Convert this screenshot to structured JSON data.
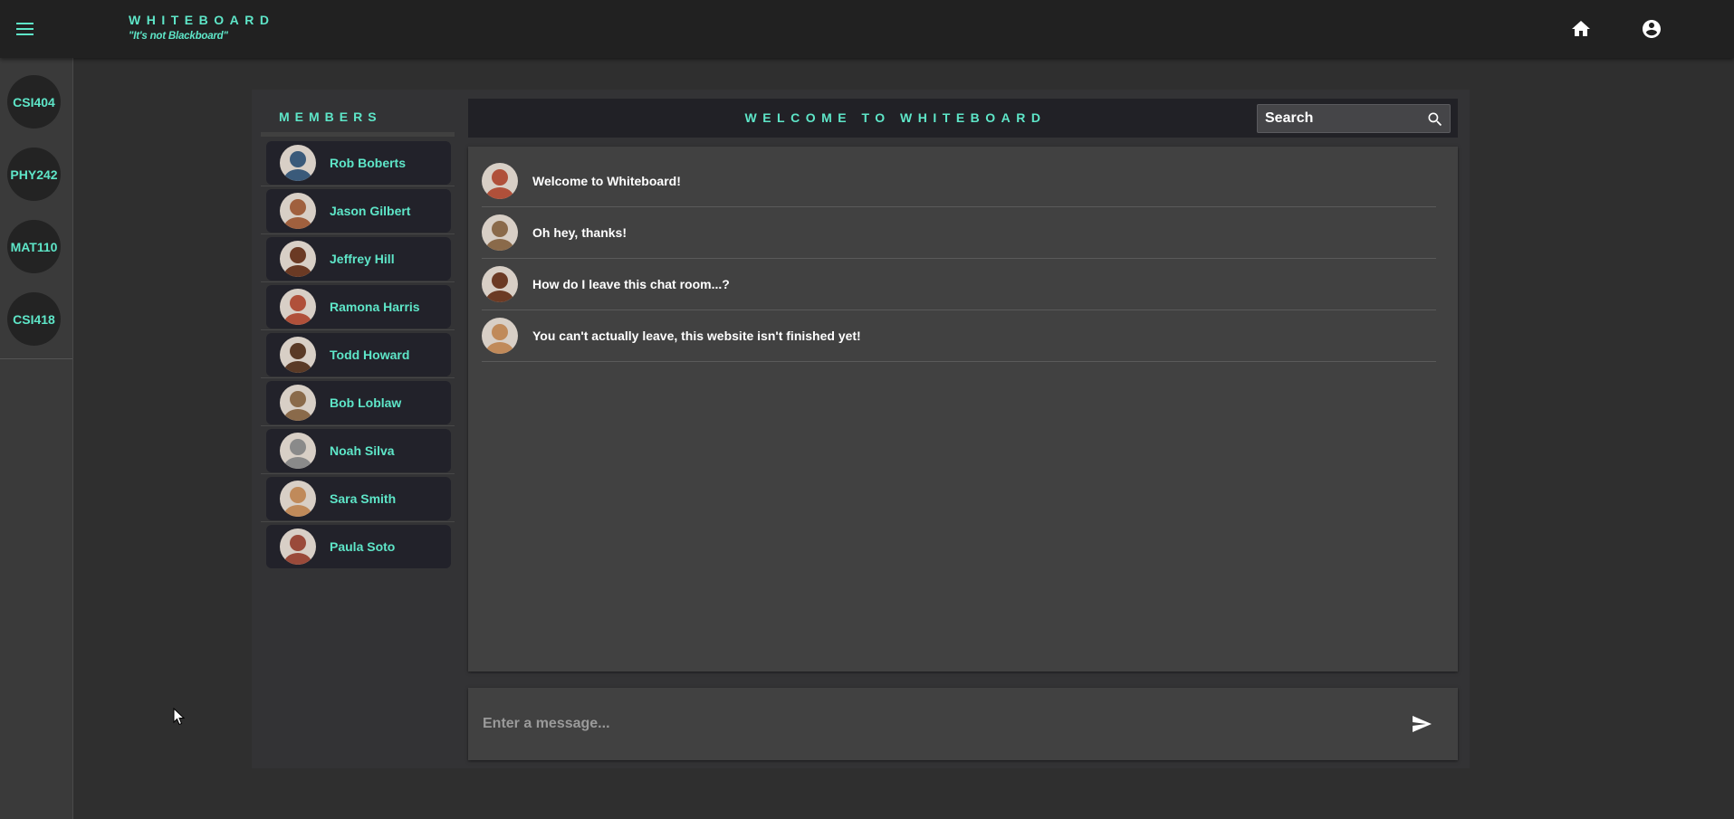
{
  "app": {
    "brand_title": "WHITEBOARD",
    "brand_subtitle": "\"It's not Blackboard\"",
    "accent_color": "#5ee6c8"
  },
  "topbar": {
    "menu_icon": "hamburger-menu-icon",
    "home_icon": "home-icon",
    "account_icon": "account-circle-icon"
  },
  "courses": [
    "CSI404",
    "PHY242",
    "MAT110",
    "CSI418"
  ],
  "members": {
    "title": "MEMBERS",
    "items": [
      {
        "name": "Rob Boberts",
        "avatar_color": "#3a5a7a"
      },
      {
        "name": "Jason Gilbert",
        "avatar_color": "#a0603e"
      },
      {
        "name": "Jeffrey Hill",
        "avatar_color": "#6b3a24"
      },
      {
        "name": "Ramona Harris",
        "avatar_color": "#b0503a"
      },
      {
        "name": "Todd Howard",
        "avatar_color": "#5a3a26"
      },
      {
        "name": "Bob Loblaw",
        "avatar_color": "#8a6a4a"
      },
      {
        "name": "Noah Silva",
        "avatar_color": "#8a8a8a"
      },
      {
        "name": "Sara Smith",
        "avatar_color": "#c08a5a"
      },
      {
        "name": "Paula Soto",
        "avatar_color": "#9a4a3a"
      }
    ]
  },
  "chat": {
    "title": "WELCOME TO WHITEBOARD",
    "search_placeholder": "Search",
    "messages": [
      {
        "text": "Welcome to Whiteboard!",
        "avatar_color": "#b0503a"
      },
      {
        "text": "Oh hey, thanks!",
        "avatar_color": "#8a6a4a"
      },
      {
        "text": "How do I leave this chat room...?",
        "avatar_color": "#6b3a24"
      },
      {
        "text": "You can't actually leave, this website isn't finished yet!",
        "avatar_color": "#c08a5a"
      }
    ],
    "composer_placeholder": "Enter a message..."
  }
}
